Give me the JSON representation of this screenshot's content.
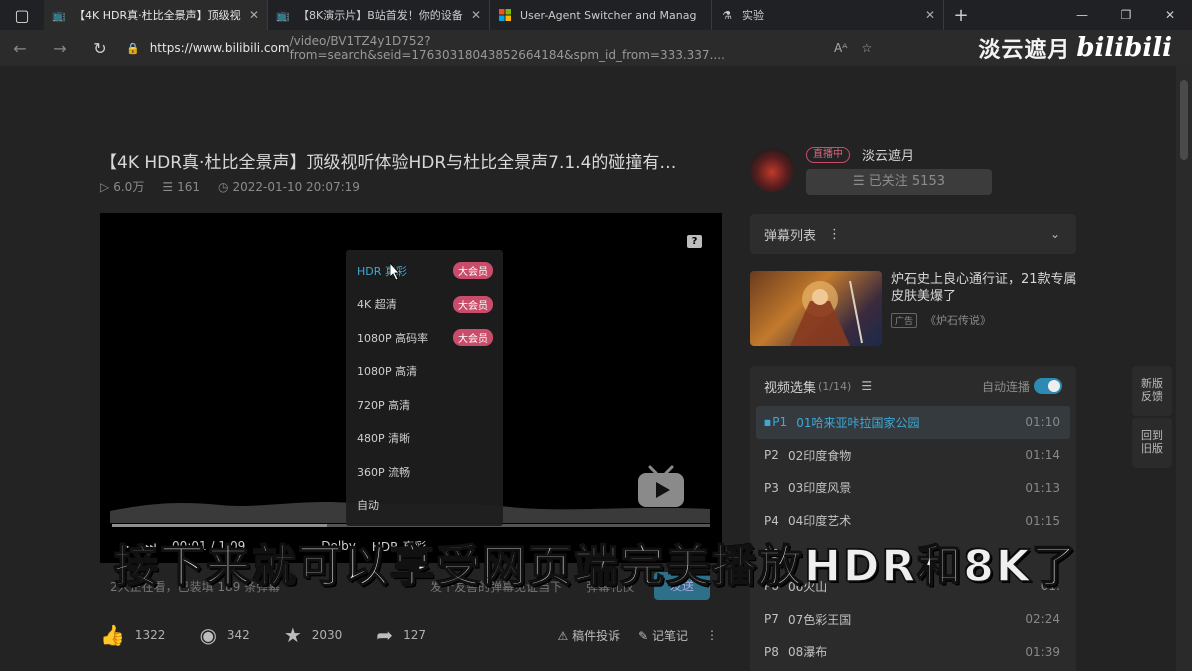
{
  "browser": {
    "tabs": [
      {
        "title": "【4K HDR真·杜比全景声】顶级视",
        "active": true
      },
      {
        "title": "【8K演示片】B站首发！你的设备",
        "active": false
      },
      {
        "title": "User-Agent Switcher and Manag",
        "active": false
      },
      {
        "title": "实验",
        "active": false
      }
    ],
    "url_host": "https://www.bilibili.com",
    "url_path": "/video/BV1TZ4y1D752?from=search&seid=17630318043852664184&spm_id_from=333.337....",
    "watermark_name": "淡云遮月",
    "watermark_logo": "bilibili"
  },
  "video": {
    "title": "【4K HDR真·杜比全景声】顶级视听体验HDR与杜比全景声7.1.4的碰撞有…",
    "views": "6.0万",
    "danmaku_count": "161",
    "date": "2022-01-10 20:07:19",
    "current_time": "00:01",
    "duration": "1:09",
    "progress_fraction": 0.36
  },
  "quality_menu": {
    "items": [
      {
        "label": "HDR 真彩",
        "vip": "大会员",
        "selected": true
      },
      {
        "label": "4K 超清",
        "vip": "大会员",
        "selected": false
      },
      {
        "label": "1080P 高码率",
        "vip": "大会员",
        "selected": false
      },
      {
        "label": "1080P 高清",
        "vip": "",
        "selected": false
      },
      {
        "label": "720P 高清",
        "vip": "",
        "selected": false
      },
      {
        "label": "480P 清晰",
        "vip": "",
        "selected": false
      },
      {
        "label": "360P 流畅",
        "vip": "",
        "selected": false
      },
      {
        "label": "自动",
        "vip": "",
        "selected": false
      }
    ]
  },
  "controls": {
    "dolby": "Dolby",
    "hdr": "HDR 真彩"
  },
  "danmaku_bar": {
    "watching": "2人正在看，已装填 189 条弹幕",
    "input_placeholder": "发个友善的弹幕见证当下",
    "etiquette": "弹幕礼仪",
    "send": "发送"
  },
  "actions": {
    "like": "1322",
    "coin": "342",
    "favorite": "2030",
    "share": "127",
    "report": "稿件投诉",
    "notes": "记笔记"
  },
  "uploader": {
    "live_badge": "直播中",
    "name": "淡云遮月",
    "follow": "已关注 5153"
  },
  "danmaku_list": {
    "label": "弹幕列表"
  },
  "ad": {
    "title": "炉石史上良心通行证，21款专属皮肤美爆了",
    "tag": "广告",
    "source": "《炉石传说》"
  },
  "playlist": {
    "title": "视频选集",
    "count": "(1/14)",
    "autoplay": "自动连播",
    "items": [
      {
        "no": "P1",
        "name": "01哈来亚咔拉国家公园",
        "dur": "01:10"
      },
      {
        "no": "P2",
        "name": "02印度食物",
        "dur": "01:14"
      },
      {
        "no": "P3",
        "name": "03印度风景",
        "dur": "01:13"
      },
      {
        "no": "P4",
        "name": "04印度艺术",
        "dur": "01:15"
      },
      {
        "no": "P5",
        "name": "",
        "dur": ""
      },
      {
        "no": "P6",
        "name": "06火山",
        "dur": "01:"
      },
      {
        "no": "P7",
        "name": "07色彩王国",
        "dur": "02:24"
      },
      {
        "no": "P8",
        "name": "08瀑布",
        "dur": "01:39"
      }
    ]
  },
  "side": {
    "feedback": "新版\n反馈",
    "old": "回到\n旧版"
  },
  "subtitle": "接下来就可以享受网页端完美播放HDR和8K了"
}
